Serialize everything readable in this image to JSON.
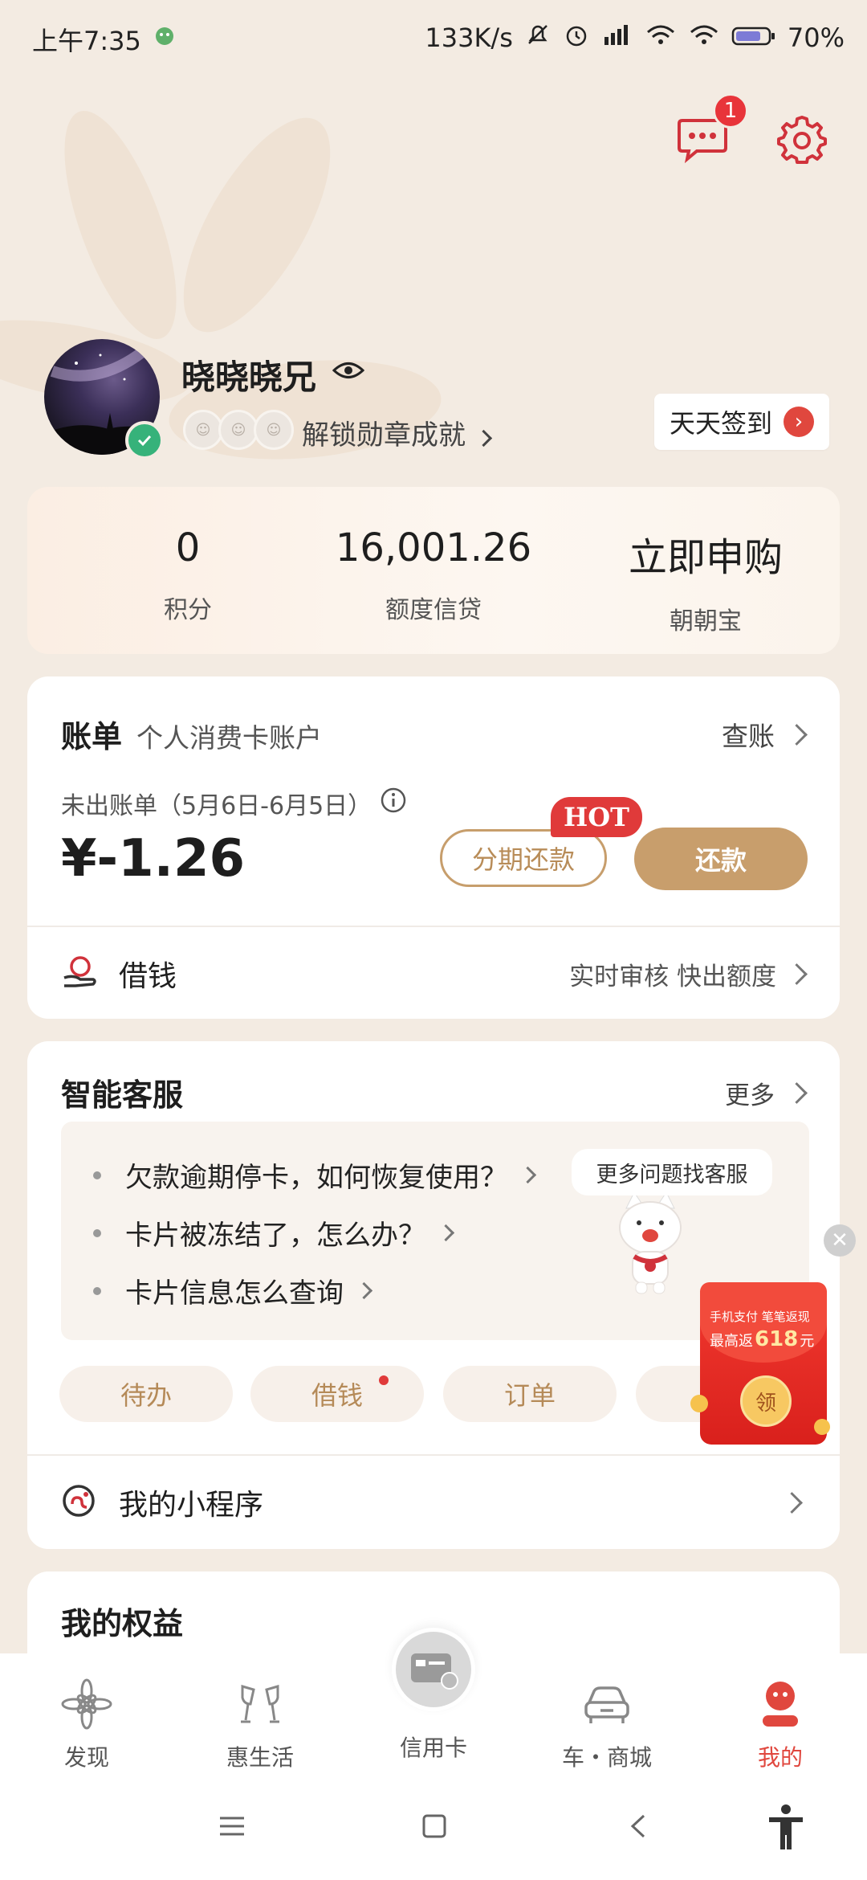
{
  "status": {
    "time": "上午7:35",
    "network_speed": "133K/s",
    "battery": "70"
  },
  "header": {
    "message_badge": "1"
  },
  "profile": {
    "name": "晓晓晓兄",
    "unlock_text": "解锁勋章成就",
    "signin_label": "天天签到"
  },
  "stats": [
    {
      "value": "0",
      "label": "积分"
    },
    {
      "value": "16,001.26",
      "label": "额度信贷"
    },
    {
      "value": "立即申购",
      "label": "朝朝宝"
    }
  ],
  "bill": {
    "title": "账单",
    "subtitle": "个人消费卡账户",
    "view_link": "查账",
    "period_label": "未出账单（5月6日-6月5日）",
    "amount": "¥-1.26",
    "hot_tag": "HOT",
    "installment_button": "分期还款",
    "repay_button": "还款",
    "borrow_label": "借钱",
    "borrow_tagline": "实时审核 快出额度"
  },
  "service": {
    "title": "智能客服",
    "more_link": "更多",
    "faqs": [
      "欠款逾期停卡，如何恢复使用？",
      "卡片被冻结了，怎么办？",
      "卡片信息怎么查询"
    ],
    "bubble": "更多问题找客服",
    "pills": [
      "待办",
      "借钱",
      "订单"
    ],
    "mini_program": "我的小程序"
  },
  "redpacket": {
    "line1": "手机支付 笔笔返现",
    "line2_prefix": "最高返",
    "amount": "618",
    "unit": "元",
    "button": "领"
  },
  "rights": {
    "title": "我的权益"
  },
  "tabs": [
    {
      "label": "发现",
      "icon": "discover-flower-icon"
    },
    {
      "label": "惠生活",
      "icon": "cheers-glasses-icon"
    },
    {
      "label": "信用卡",
      "icon": "credit-card-icon"
    },
    {
      "label": "车・商城",
      "icon": "car-icon"
    },
    {
      "label": "我的",
      "icon": "my-profile-icon"
    }
  ],
  "colors": {
    "accent": "#c89e6c",
    "red": "#e03a3a",
    "active_tab": "#e0473e",
    "background": "#f3ebe2"
  }
}
